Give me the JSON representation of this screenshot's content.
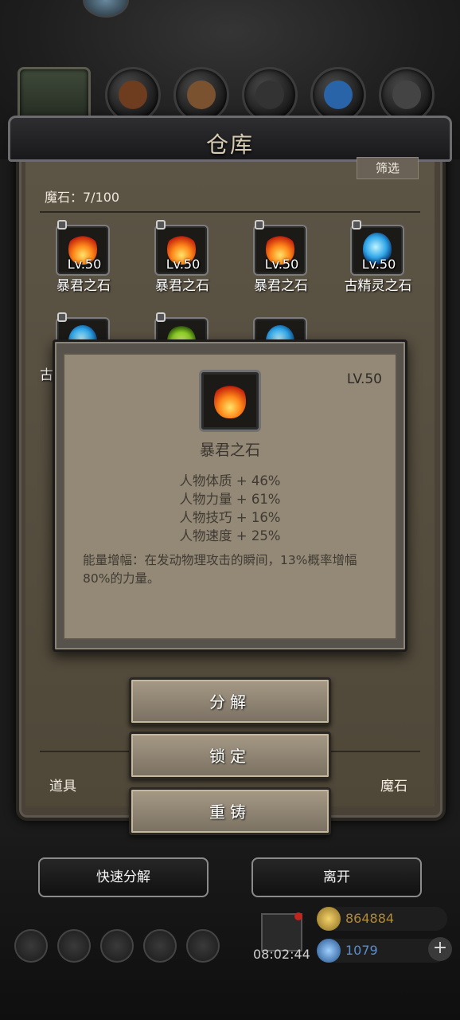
{
  "window": {
    "title": "仓库"
  },
  "toolbar": {
    "filter_label": "筛选"
  },
  "inventory": {
    "count_text": "魔石：7/100",
    "items": [
      {
        "level": "Lv.50",
        "name": "暴君之石",
        "gem": "fire-gem",
        "locked": true
      },
      {
        "level": "Lv.50",
        "name": "暴君之石",
        "gem": "fire-gem",
        "locked": true
      },
      {
        "level": "Lv.50",
        "name": "暴君之石",
        "gem": "fire-gem",
        "locked": true
      },
      {
        "level": "Lv.50",
        "name": "古精灵之石",
        "gem": "blue-gem",
        "locked": true
      },
      {
        "name": "古",
        "gem": "blue-gem",
        "locked": true
      },
      {
        "gem": "green-gem",
        "locked": true
      },
      {
        "gem": "blue-gem",
        "locked": false
      }
    ]
  },
  "tooltip": {
    "level": "LV.50",
    "name": "暴君之石",
    "icon": "fire-gem",
    "stats": [
      "人物体质 + 46%",
      "人物力量 + 61%",
      "人物技巧 + 16%",
      "人物速度 + 25%"
    ],
    "description": "能量增幅：在发动物理攻击的瞬间，13%概率增幅80%的力量。"
  },
  "actions": {
    "decompose": "分解",
    "lock": "锁定",
    "reforge": "重铸"
  },
  "bottom_tabs": {
    "items": "道具",
    "magic_stones": "魔石"
  },
  "footer": {
    "quick_decompose": "快速分解",
    "leave": "离开"
  },
  "hud": {
    "timer": "08:02:44",
    "gold": "864884",
    "gems": "1079"
  },
  "colors": {
    "panel": "#4a4236",
    "tooltip_bg": "#948977",
    "button": "#8f8472",
    "gold_text": "#b08a3c",
    "gem_text": "#5a8ed0"
  }
}
